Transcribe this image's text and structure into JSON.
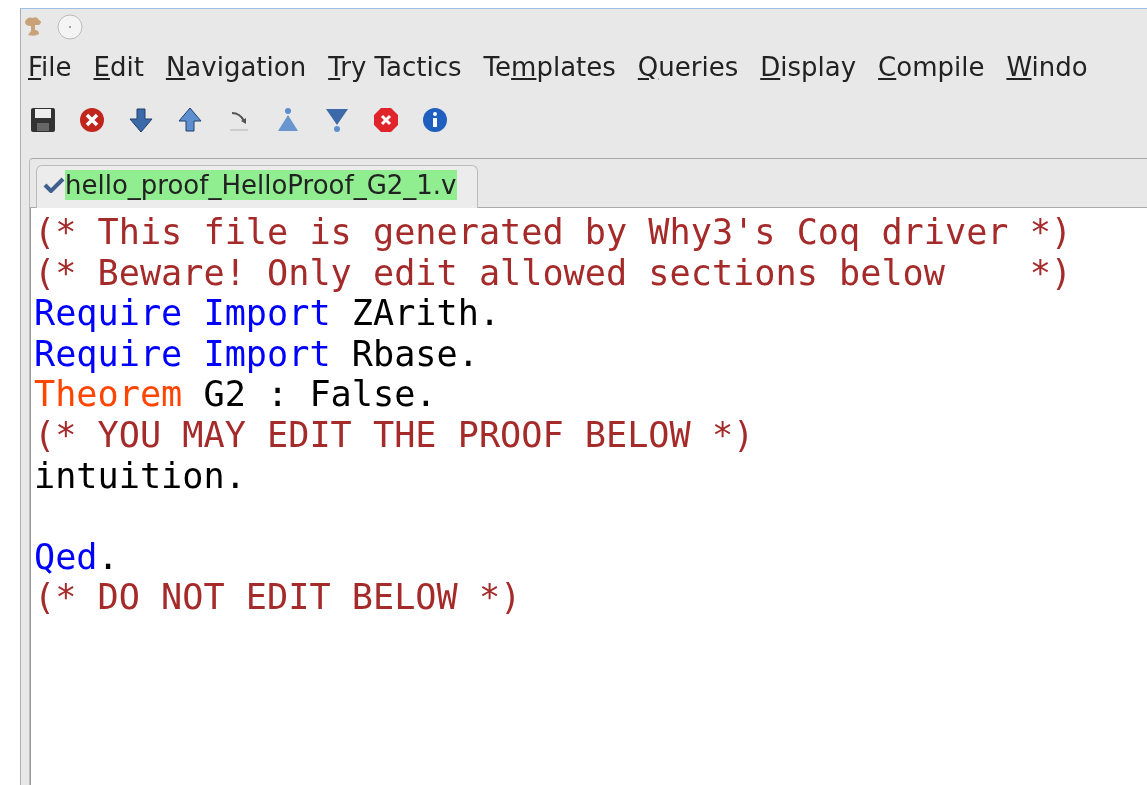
{
  "menu": [
    {
      "key": "F",
      "post": "ile"
    },
    {
      "key": "E",
      "post": "dit"
    },
    {
      "key": "N",
      "post": "avigation"
    },
    {
      "key": "T",
      "post": "ry Tactics"
    },
    {
      "pre": "Te",
      "key": "m",
      "post": "plates"
    },
    {
      "key": "Q",
      "post": "ueries"
    },
    {
      "key": "D",
      "post": "isplay"
    },
    {
      "key": "C",
      "post": "ompile"
    },
    {
      "key": "W",
      "post": "indo"
    }
  ],
  "tabs": [
    {
      "label": "hello_proof_HelloProof_G2_1.v",
      "selected": true,
      "saved": true
    }
  ],
  "code": [
    {
      "kind": "text",
      "segments": [
        {
          "kind": "comment",
          "text": "(* This file is generated by Why3's Coq driver *)"
        }
      ]
    },
    {
      "kind": "text",
      "segments": [
        {
          "kind": "comment",
          "text": "(* Beware! Only edit allowed sections below    *)"
        }
      ]
    },
    {
      "kind": "text",
      "segments": [
        {
          "kind": "keyword",
          "text": "Require Import"
        },
        {
          "kind": "plain",
          "text": " ZArith."
        }
      ]
    },
    {
      "kind": "text",
      "segments": [
        {
          "kind": "keyword",
          "text": "Require Import"
        },
        {
          "kind": "plain",
          "text": " Rbase."
        }
      ]
    },
    {
      "kind": "text",
      "segments": [
        {
          "kind": "decl",
          "text": "Theorem"
        },
        {
          "kind": "plain",
          "text": " G2 : False."
        }
      ]
    },
    {
      "kind": "text",
      "segments": [
        {
          "kind": "comment",
          "text": "(* YOU MAY EDIT THE PROOF BELOW *)"
        }
      ]
    },
    {
      "kind": "text",
      "segments": [
        {
          "kind": "plain",
          "text": "intuition."
        }
      ]
    },
    {
      "kind": "blank"
    },
    {
      "kind": "text",
      "segments": [
        {
          "kind": "keyword",
          "text": "Qed"
        },
        {
          "kind": "plain",
          "text": "."
        }
      ]
    },
    {
      "kind": "text",
      "segments": [
        {
          "kind": "comment",
          "text": "(* DO NOT EDIT BELOW *)"
        }
      ]
    }
  ]
}
